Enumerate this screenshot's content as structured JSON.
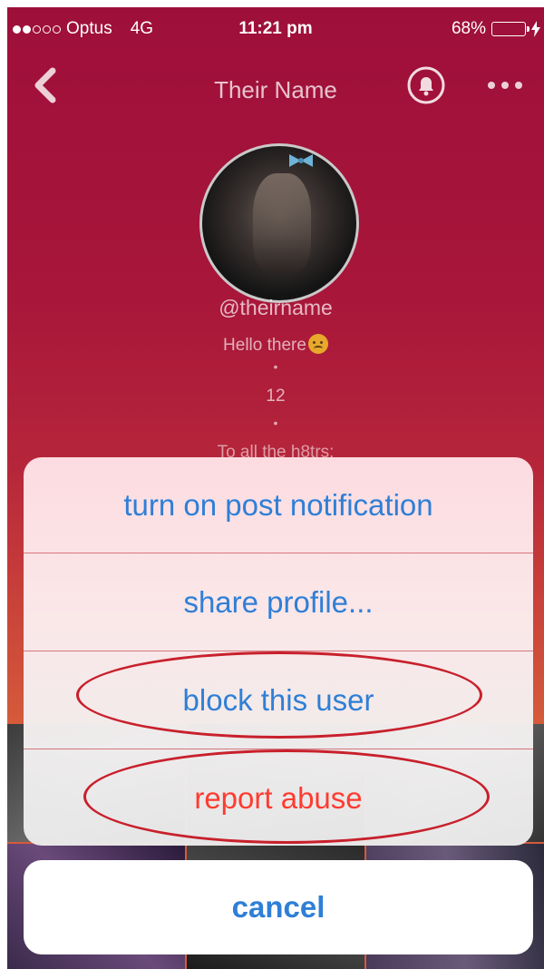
{
  "status_bar": {
    "carrier": "Optus",
    "network": "4G",
    "time": "11:21 pm",
    "battery": "68%",
    "battery_level": 0.68
  },
  "nav": {
    "title": "Their Name"
  },
  "profile": {
    "handle": "@theirname",
    "bio_line1": "Hello there",
    "separator": "•",
    "bio_line2": "12",
    "bio_line3": "To all the h8trs:"
  },
  "action_sheet": {
    "options": [
      {
        "label": "turn on post notification",
        "color": "#2f7fd6"
      },
      {
        "label": "share profile...",
        "color": "#2f7fd6"
      },
      {
        "label": "block this user",
        "color": "#2f7fd6"
      },
      {
        "label": "report abuse",
        "color": "#ff3b30"
      }
    ],
    "cancel_label": "cancel"
  },
  "colors": {
    "accent_blue": "#2f7fd6",
    "destructive_red": "#ff3b30",
    "highlight_ring": "#c8202c",
    "battery_green": "#4cd964"
  }
}
